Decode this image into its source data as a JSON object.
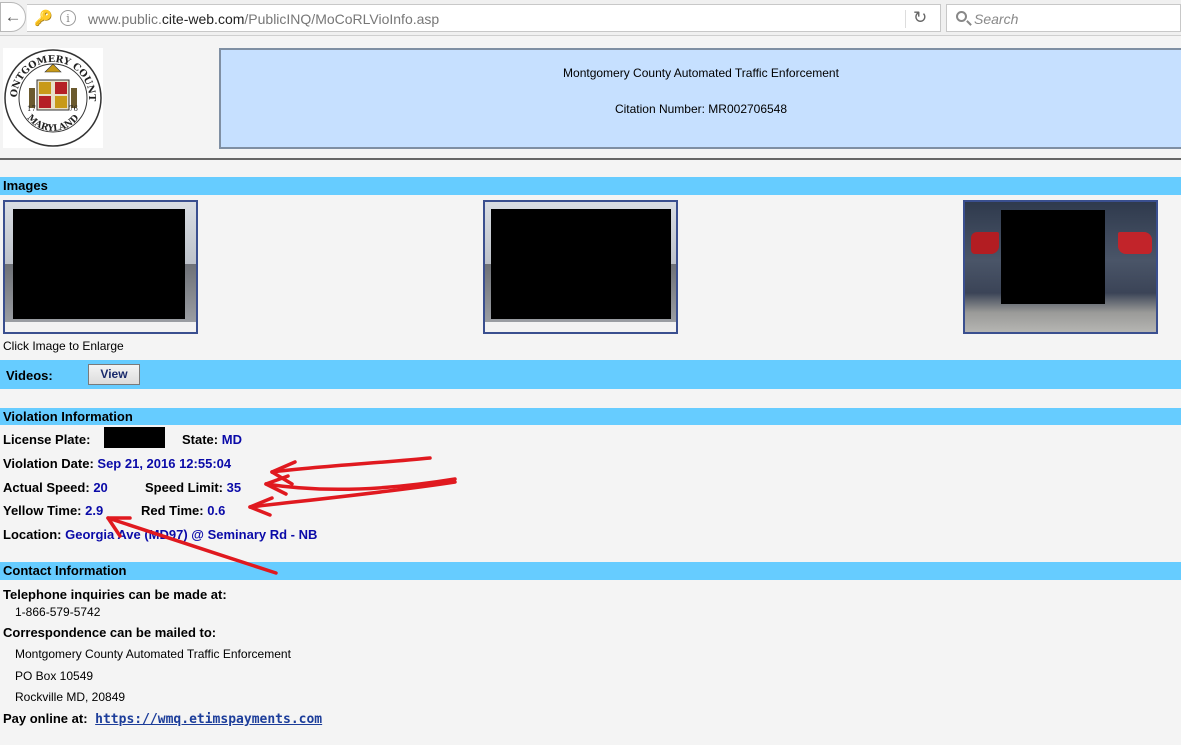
{
  "browser": {
    "url_prefix": "www.public.",
    "url_domain": "cite-web.com",
    "url_path": "/PublicINQ/MoCoRLVioInfo.asp",
    "search_placeholder": "Search"
  },
  "header": {
    "logo_top_text": "MONTGOMERY COUNTY",
    "logo_bottom_text": "MARYLAND",
    "logo_year_left": "17",
    "logo_year_right": "76",
    "title": "Montgomery County Automated Traffic Enforcement",
    "citation": "Citation Number: MR002706548"
  },
  "images": {
    "section_title": "Images",
    "click_hint": "Click Image to Enlarge"
  },
  "videos": {
    "label": "Videos:",
    "button": "View"
  },
  "violation": {
    "section_title": "Violation Information",
    "plate_label": "License Plate:",
    "state_label": "State:",
    "state_value": "MD",
    "date_label": "Violation Date:",
    "date_value": "Sep 21, 2016 12:55:04",
    "speed_label": "Actual Speed:",
    "speed_value": "20",
    "limit_label": "Speed Limit:",
    "limit_value": "35",
    "yellow_label": "Yellow Time:",
    "yellow_value": "2.9",
    "red_label": "Red Time:",
    "red_value": "0.6",
    "location_label": "Location:",
    "location_value": "Georgia Ave (MD97) @ Seminary Rd - NB"
  },
  "contact": {
    "section_title": "Contact Information",
    "phone_label": "Telephone inquiries can be made at:",
    "phone_value": "1-866-579-5742",
    "mail_label": "Correspondence can be mailed to:",
    "mail_line1": "Montgomery County Automated Traffic Enforcement",
    "mail_line2": "PO Box 10549",
    "mail_line3": "Rockville MD, 20849",
    "pay_label": "Pay online at:",
    "pay_link": "https://wmq.etimspayments.com"
  },
  "colors": {
    "section_bar": "#66ccff",
    "header_box": "#c6e0ff",
    "value_text": "#0a0aa8",
    "annotation_arrow": "#e0191f"
  }
}
